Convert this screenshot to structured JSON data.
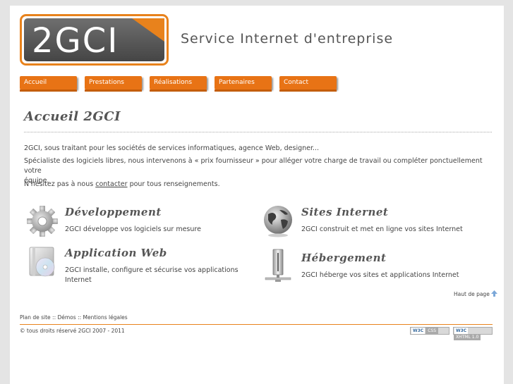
{
  "logo": {
    "text": "2GCI"
  },
  "tagline": "Service Internet d'entreprise",
  "nav": [
    "Accueil",
    "Prestations",
    "Réalisations",
    "Partenaires",
    "Contact"
  ],
  "main": {
    "title": "Accueil 2GCI",
    "intro": "2GCI, sous traitant pour les sociétés de services informatiques, agence Web, designer...",
    "specialist_line1": "Spécialiste des logiciels libres, nous intervenons à « prix fournisseur » pour alléger votre charge de travail ou compléter ponctuellement votre",
    "specialist_line2": "équipe.",
    "contact_pre": "N'hésitez pas à nous ",
    "contact_link": "contacter",
    "contact_post": " pour tous renseignements."
  },
  "features": {
    "dev": {
      "title": "Développement",
      "desc": "2GCI développe vos logiciels sur mesure",
      "icon": "gear-icon"
    },
    "sites": {
      "title": "Sites Internet",
      "desc": "2GCI construit et met en ligne vos sites Internet",
      "icon": "globe-icon"
    },
    "app": {
      "title": "Application Web",
      "desc1": "2GCI installe, configure et sécurise vos applications",
      "desc2": "Internet",
      "icon": "cd-icon"
    },
    "host": {
      "title": "Hébergement",
      "desc": "2GCI héberge vos sites et applications Internet",
      "icon": "server-icon"
    }
  },
  "top_link": "Haut de page",
  "footer": {
    "plan": "Plan de site",
    "sep1": " :: ",
    "demos": "Démos",
    "sep2": " :: ",
    "legal": "Mentions légales",
    "copyright": "© tous droits réservé 2GCI 2007 - 2011",
    "badge_css": {
      "w3c": "W3C",
      "label": "CSS"
    },
    "badge_xhtml": {
      "w3c": "W3C",
      "label": "XHTML 1.0"
    }
  },
  "colors": {
    "accent": "#e8821c",
    "nav": "#e87315",
    "text": "#444444"
  }
}
